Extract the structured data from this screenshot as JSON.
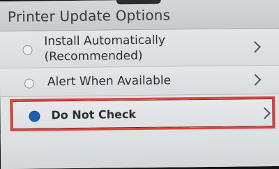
{
  "header": {
    "title": "Printer Update Options"
  },
  "options": [
    {
      "label_line1": "Install Automatically",
      "label_line2": "(Recommended)",
      "selected": false,
      "icon": "chevron-right-icon"
    },
    {
      "label": "Alert When Available",
      "selected": false,
      "icon": "chevron-right-icon"
    },
    {
      "label": "Do Not Check",
      "selected": true,
      "icon": "chevron-right-icon"
    }
  ],
  "colors": {
    "selected_radio": "#1f5fb0",
    "highlight_border": "#e0423c"
  }
}
